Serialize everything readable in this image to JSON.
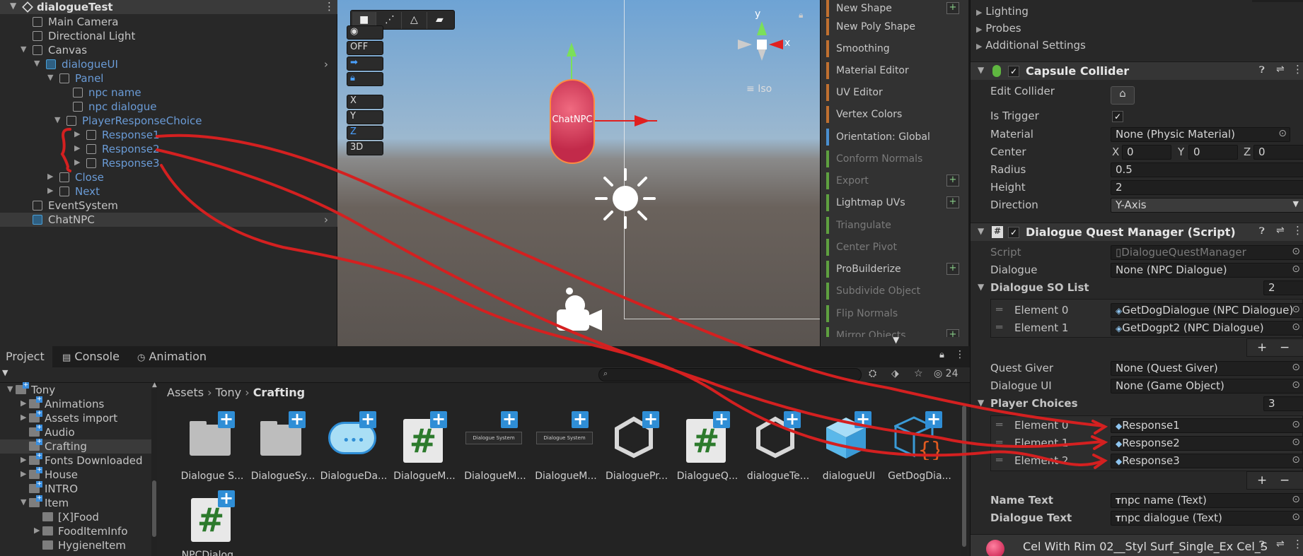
{
  "hierarchy": {
    "scene": "dialogueTest",
    "items": [
      {
        "label": "Main Camera",
        "depth": 0,
        "expand": "",
        "blue": false,
        "sel": false,
        "arrow": false
      },
      {
        "label": "Directional Light",
        "depth": 0,
        "expand": "",
        "blue": false,
        "sel": false,
        "arrow": false
      },
      {
        "label": "Canvas",
        "depth": 0,
        "expand": "▼",
        "blue": false,
        "sel": false,
        "arrow": false
      },
      {
        "label": "dialogueUI",
        "depth": 1,
        "expand": "▼",
        "blue": true,
        "sel": false,
        "arrow": true,
        "prefab": true
      },
      {
        "label": "Panel",
        "depth": 2,
        "expand": "▼",
        "blue": true,
        "sel": false,
        "arrow": false
      },
      {
        "label": "npc name",
        "depth": 3,
        "expand": "",
        "blue": true,
        "sel": false,
        "arrow": false
      },
      {
        "label": "npc dialogue",
        "depth": 3,
        "expand": "",
        "blue": true,
        "sel": false,
        "arrow": false
      },
      {
        "label": "PlayerResponseChoice",
        "depth": 3,
        "expand": "▼",
        "blue": true,
        "sel": false,
        "arrow": false,
        "shift": -1
      },
      {
        "label": "Response1",
        "depth": 4,
        "expand": "▶",
        "blue": true,
        "sel": false,
        "arrow": false
      },
      {
        "label": "Response2",
        "depth": 4,
        "expand": "▶",
        "blue": true,
        "sel": false,
        "arrow": false
      },
      {
        "label": "Response3",
        "depth": 4,
        "expand": "▶",
        "blue": true,
        "sel": false,
        "arrow": false
      },
      {
        "label": "Close",
        "depth": 2,
        "expand": "▶",
        "blue": true,
        "sel": false,
        "arrow": false
      },
      {
        "label": "Next",
        "depth": 2,
        "expand": "▶",
        "blue": true,
        "sel": false,
        "arrow": false
      },
      {
        "label": "EventSystem",
        "depth": 0,
        "expand": "",
        "blue": false,
        "sel": false,
        "arrow": false
      },
      {
        "label": "ChatNPC",
        "depth": 0,
        "expand": "",
        "blue": false,
        "sel": true,
        "arrow": true,
        "prefab": true
      }
    ]
  },
  "scene": {
    "overlay_buttons": [
      "OFF",
      "X",
      "Y",
      "Z",
      "3D"
    ],
    "gizmo": {
      "y": "y",
      "x": "x",
      "projection": "Iso"
    },
    "npc_label": "ChatNPC"
  },
  "probuilder": {
    "items": [
      {
        "label": "New Shape",
        "color": "orange",
        "dim": false,
        "plus": true
      },
      {
        "label": "New Poly Shape",
        "color": "orange",
        "dim": false,
        "plus": false
      },
      {
        "label": "Smoothing",
        "color": "orange",
        "dim": false,
        "plus": false
      },
      {
        "label": "Material Editor",
        "color": "orange",
        "dim": false,
        "plus": false
      },
      {
        "label": "UV Editor",
        "color": "orange",
        "dim": false,
        "plus": false
      },
      {
        "label": "Vertex Colors",
        "color": "orange",
        "dim": false,
        "plus": false
      },
      {
        "label": "Orientation: Global",
        "color": "blue",
        "dim": false,
        "plus": false
      },
      {
        "label": "Conform Normals",
        "color": "green",
        "dim": true,
        "plus": false
      },
      {
        "label": "Export",
        "color": "green",
        "dim": true,
        "plus": true
      },
      {
        "label": "Lightmap UVs",
        "color": "green",
        "dim": false,
        "plus": true
      },
      {
        "label": "Triangulate",
        "color": "green",
        "dim": true,
        "plus": false
      },
      {
        "label": "Center Pivot",
        "color": "green",
        "dim": true,
        "plus": false
      },
      {
        "label": "ProBuilderize",
        "color": "green",
        "dim": false,
        "plus": true
      },
      {
        "label": "Subdivide Object",
        "color": "green",
        "dim": true,
        "plus": false
      },
      {
        "label": "Flip Normals",
        "color": "green",
        "dim": true,
        "plus": false
      },
      {
        "label": "Mirror Objects",
        "color": "green",
        "dim": true,
        "plus": true
      }
    ],
    "scroll_arrow": "▼"
  },
  "inspector": {
    "foldouts": [
      "Lighting",
      "Probes",
      "Additional Settings"
    ],
    "collider": {
      "title": "Capsule Collider",
      "edit_collider": "Edit Collider",
      "is_trigger": "Is Trigger",
      "material_label": "Material",
      "material": "None (Physic Material)",
      "center_label": "Center",
      "cx": "0",
      "cy": "0",
      "cz": "0",
      "radius_label": "Radius",
      "radius": "0.5",
      "height_label": "Height",
      "height": "2",
      "direction_label": "Direction",
      "direction": "Y-Axis"
    },
    "script": {
      "title": "Dialogue Quest Manager (Script)",
      "script_label": "Script",
      "script_value": "DialogueQuestManager",
      "dialogue_label": "Dialogue",
      "dialogue_value": "None (NPC Dialogue)",
      "so_list_label": "Dialogue SO List",
      "so_list_count": "2",
      "so_elements": [
        {
          "label": "Element 0",
          "value": "GetDogDialogue (NPC Dialogue)"
        },
        {
          "label": "Element 1",
          "value": "GetDogpt2 (NPC Dialogue)"
        }
      ],
      "quest_giver_label": "Quest Giver",
      "quest_giver_value": "None (Quest Giver)",
      "dialogue_ui_label": "Dialogue UI",
      "dialogue_ui_value": "None (Game Object)",
      "player_choices_label": "Player Choices",
      "player_choices_count": "3",
      "choices": [
        {
          "label": "Element 0",
          "value": "Response1"
        },
        {
          "label": "Element 1",
          "value": "Response2"
        },
        {
          "label": "Element 2",
          "value": "Response3"
        }
      ],
      "name_text_label": "Name Text",
      "name_text_value": "npc name (Text)",
      "dialogue_text_label": "Dialogue Text",
      "dialogue_text_value": "npc dialogue  (Text)",
      "plus": "+",
      "minus": "−"
    },
    "material_row": "Cel With Rim 02__Styl Surf_Single_Ex Cel_S"
  },
  "project": {
    "tabs": [
      "Project",
      "Console",
      "Animation"
    ],
    "hidden_count": "24",
    "breadcrumb": [
      "Assets",
      "Tony",
      "Crafting"
    ],
    "tree": [
      {
        "label": "Tony",
        "depth": 0,
        "expand": "▼",
        "sel": false
      },
      {
        "label": "Animations",
        "depth": 1,
        "expand": "▶",
        "sel": false
      },
      {
        "label": "Assets import",
        "depth": 1,
        "expand": "▶",
        "sel": false
      },
      {
        "label": "Audio",
        "depth": 1,
        "expand": "",
        "sel": false
      },
      {
        "label": "Crafting",
        "depth": 1,
        "expand": "",
        "sel": true
      },
      {
        "label": "Fonts Downloaded",
        "depth": 1,
        "expand": "▶",
        "sel": false
      },
      {
        "label": "House",
        "depth": 1,
        "expand": "▶",
        "sel": false
      },
      {
        "label": "INTRO",
        "depth": 1,
        "expand": "",
        "sel": false
      },
      {
        "label": "Item",
        "depth": 1,
        "expand": "▼",
        "sel": false
      },
      {
        "label": "[X]Food",
        "depth": 2,
        "expand": "",
        "sel": false
      },
      {
        "label": "FoodItemInfo",
        "depth": 2,
        "expand": "▶",
        "sel": false
      },
      {
        "label": "HygieneItem",
        "depth": 2,
        "expand": "",
        "sel": false
      }
    ],
    "assets": [
      {
        "name": "Dialogue S...",
        "kind": "folder"
      },
      {
        "name": "DialogueSy...",
        "kind": "folder"
      },
      {
        "name": "DialogueDa...",
        "kind": "bubble"
      },
      {
        "name": "DialogueM...",
        "kind": "script"
      },
      {
        "name": "DialogueM...",
        "kind": "banner",
        "banner_text": "Dialogue System"
      },
      {
        "name": "DialogueM...",
        "kind": "banner",
        "banner_text": "Dialogue System"
      },
      {
        "name": "DialoguePr...",
        "kind": "unity"
      },
      {
        "name": "DialogueQ...",
        "kind": "script"
      },
      {
        "name": "dialogueTe...",
        "kind": "unity"
      },
      {
        "name": "dialogueUI",
        "kind": "cube"
      },
      {
        "name": "GetDogDia...",
        "kind": "so"
      },
      {
        "name": "NPCDialog...",
        "kind": "script"
      }
    ]
  },
  "colors": {
    "annotation": "#d42020",
    "accent": "#2f8ed6"
  }
}
